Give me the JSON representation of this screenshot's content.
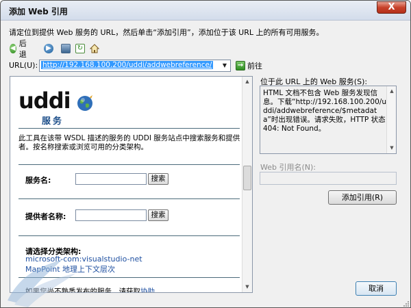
{
  "window": {
    "title": "添加 Web 引用",
    "close_label": "X"
  },
  "instruction": "请定位到提供 Web 服务的 URL，然后单击“添加引用”，添加位于该 URL 上的所有可用服务。",
  "toolbar": {
    "back_label": "后退"
  },
  "url_bar": {
    "label": "URL(U):",
    "value": "http://192.168.100.200/uddi/addwebreference/",
    "go_label": "前往"
  },
  "browser": {
    "logo_word": "uddi",
    "logo_sub": "服务",
    "description": "此工具在该带 WSDL 描述的服务的 UDDI 服务站点中搜索服务和提供者。按名称搜索或浏览可用的分类架构。",
    "service_name_label": "服务名:",
    "provider_name_label": "提供者名称:",
    "search_label": "搜索",
    "category_title": "请选择分类架构:",
    "links": [
      "microsoft-com:visualstudio-net",
      "MapPoint 地理上下文层次"
    ],
    "footer_text": "如果您尚不熟悉发布的服务，请获取",
    "footer_link": "协助。"
  },
  "right_panel": {
    "services_title": "位于此 URL 上的 Web 服务(S):",
    "message": "HTML 文档不包含 Web 服务发现信息。下载“http://192.168.100.200/uddi/addwebreference/$metadata”时出现错误。请求失败，HTTP 状态 404: Not Found。",
    "ref_name_label": "Web 引用名(N):",
    "ref_name_value": "",
    "add_ref_label": "添加引用(R)"
  },
  "cancel_label": "取消"
}
